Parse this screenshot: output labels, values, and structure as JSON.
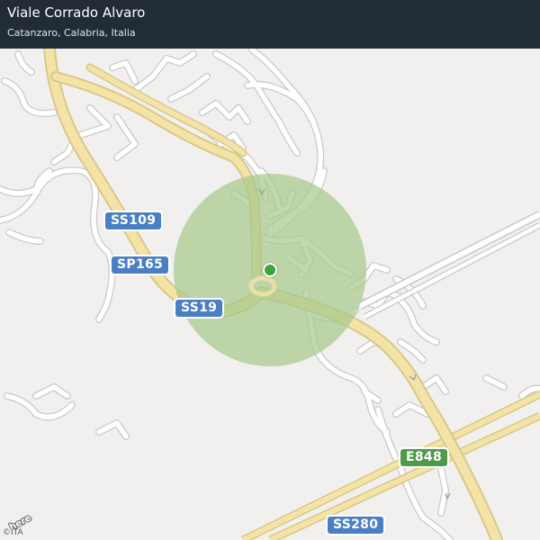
{
  "header": {
    "title": "Viale Corrado Alvaro",
    "subtitle": "Catanzaro, Calabria, Italia"
  },
  "road_labels": {
    "ss109": "SS109",
    "sp165": "SP165",
    "ss19": "SS19",
    "e848": "E848",
    "ss280": "SS280"
  },
  "map": {
    "provider_logo": "here",
    "copyright": "©ITA",
    "location_marker_icon": "location-dot-icon",
    "accuracy_circle_color": "#a8c98d",
    "colors": {
      "background": "#f1f0ee",
      "minor_road": "#ffffff",
      "minor_road_casing": "#c9c9c9",
      "major_road": "#f4e3a6",
      "major_road_casing": "#d8c888",
      "highway_badge": "#4a7fc6",
      "european_route_badge": "#4f9a4a",
      "marker": "#3aa63a"
    }
  }
}
